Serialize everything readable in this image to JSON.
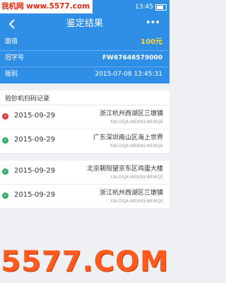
{
  "status_bar": {
    "watermark": "我机网 www.5577.com",
    "time": "13:45"
  },
  "navbar": {
    "title": "鉴定结果",
    "more_label": "•••"
  },
  "info": {
    "denomination_label": "面值",
    "denomination_value": "100元",
    "serial_label": "冠字号",
    "serial_value": "FW67646579000",
    "version_label": "版别",
    "version_value": "2015-07-08   13:45:31"
  },
  "records_section": {
    "title": "验钞机扫码记录",
    "items": [
      {
        "date": "2015-09-29",
        "location": "浙江杭州西湖区三墩镇",
        "code": "XW-DSJA-WEKWJ-WEWQE",
        "status": "red"
      },
      {
        "date": "2015-09-29",
        "location": "广东深圳南山区海上世界",
        "code": "XW-DSJA-WEKWJ-WEWQE",
        "status": "green"
      },
      {
        "date": "2015-09-29",
        "location": "北京朝阳望京东区鸡蛋大楼",
        "code": "XW-DSJA-WEKWJ-WEWQE",
        "status": "green"
      },
      {
        "date": "2015-09-29",
        "location": "浙江杭州西湖区三墩镇",
        "code": "XW-DSJA-WEKWJ-WEWQE",
        "status": "green"
      }
    ]
  },
  "footer_watermark": "5577.COM",
  "colors": {
    "primary": "#2f8fe6",
    "amount": "#ffd43a",
    "dot_red": "#e03a3a",
    "dot_green": "#2fae68",
    "watermark": "#ff5a1f"
  }
}
